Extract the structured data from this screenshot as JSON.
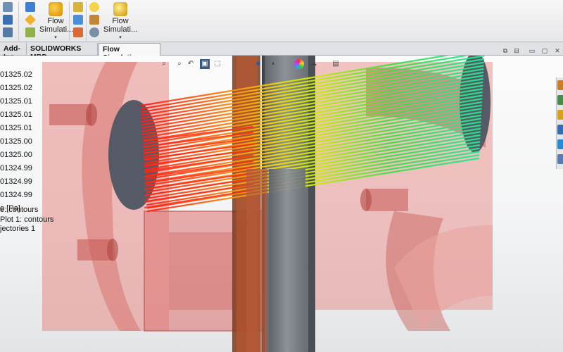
{
  "ribbon": {
    "flow_sim_label": "Flow Simulati...",
    "flow_sim_line1": "Flow",
    "flow_sim_line2": "Simulati...",
    "flow_sim_b_line1": "Flow",
    "flow_sim_b_line2": "Simulati...",
    "dropdown_arrow": "▾"
  },
  "tabs": [
    {
      "label": "Add-Ins"
    },
    {
      "label": "SOLIDWORKS MBD"
    },
    {
      "label": "Flow Simulation"
    }
  ],
  "legend": {
    "values": [
      "01325.02",
      "01325.02",
      "01325.01",
      "01325.01",
      "01325.01",
      "01325.00",
      "01325.00",
      "01324.99",
      "01324.99",
      "01324.99"
    ],
    "units": "e [Pa]",
    "caption": [
      "e: contours",
      "Plot 1: contours",
      "jectories 1"
    ]
  },
  "colors": {
    "housing": "#e07a78",
    "shaft": "#7a7f86",
    "flow_start": "#ff1a1a",
    "flow_mid": "#e8f000",
    "flow_end": "#20e8a0",
    "accent_tab": "#f8f8f8"
  },
  "icons": {
    "hud": [
      "zoom-to-fit-icon",
      "zoom-area-icon",
      "previous-view-icon",
      "section-view-icon",
      "view-orientation-icon",
      "display-style-icon",
      "hide-show-icon",
      "edit-appearance-icon",
      "apply-scene-icon",
      "view-settings-icon"
    ],
    "window": [
      "restore-icon",
      "tile-icon",
      "minimize-icon",
      "maximize-icon",
      "close-icon"
    ]
  }
}
